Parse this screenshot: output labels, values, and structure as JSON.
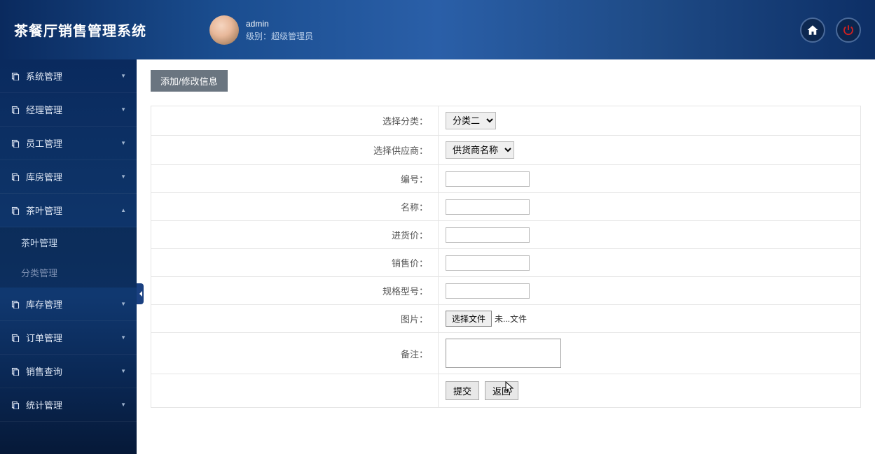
{
  "header": {
    "logo": "茶餐厅销售管理系统",
    "username": "admin",
    "role_label": "级别：",
    "role_value": "超级管理员"
  },
  "sidebar": {
    "items": [
      {
        "label": "系统管理",
        "expanded": false
      },
      {
        "label": "经理管理",
        "expanded": false
      },
      {
        "label": "员工管理",
        "expanded": false
      },
      {
        "label": "库房管理",
        "expanded": false
      },
      {
        "label": "茶叶管理",
        "expanded": true,
        "children": [
          {
            "label": "茶叶管理",
            "active": true
          },
          {
            "label": "分类管理",
            "active": false
          }
        ]
      },
      {
        "label": "库存管理",
        "expanded": false
      },
      {
        "label": "订单管理",
        "expanded": false
      },
      {
        "label": "销售查询",
        "expanded": false
      },
      {
        "label": "统计管理",
        "expanded": false
      }
    ]
  },
  "content": {
    "section_title": "添加/修改信息",
    "fields": {
      "category_label": "选择分类：",
      "category_value": "分类二",
      "supplier_label": "选择供应商：",
      "supplier_value": "供货商名称",
      "code_label": "编号：",
      "name_label": "名称：",
      "purchase_price_label": "进货价：",
      "sale_price_label": "销售价：",
      "spec_label": "规格型号：",
      "image_label": "图片：",
      "file_button": "选择文件",
      "file_text": "未...文件",
      "remark_label": "备注："
    },
    "buttons": {
      "submit": "提交",
      "back": "返回"
    }
  }
}
